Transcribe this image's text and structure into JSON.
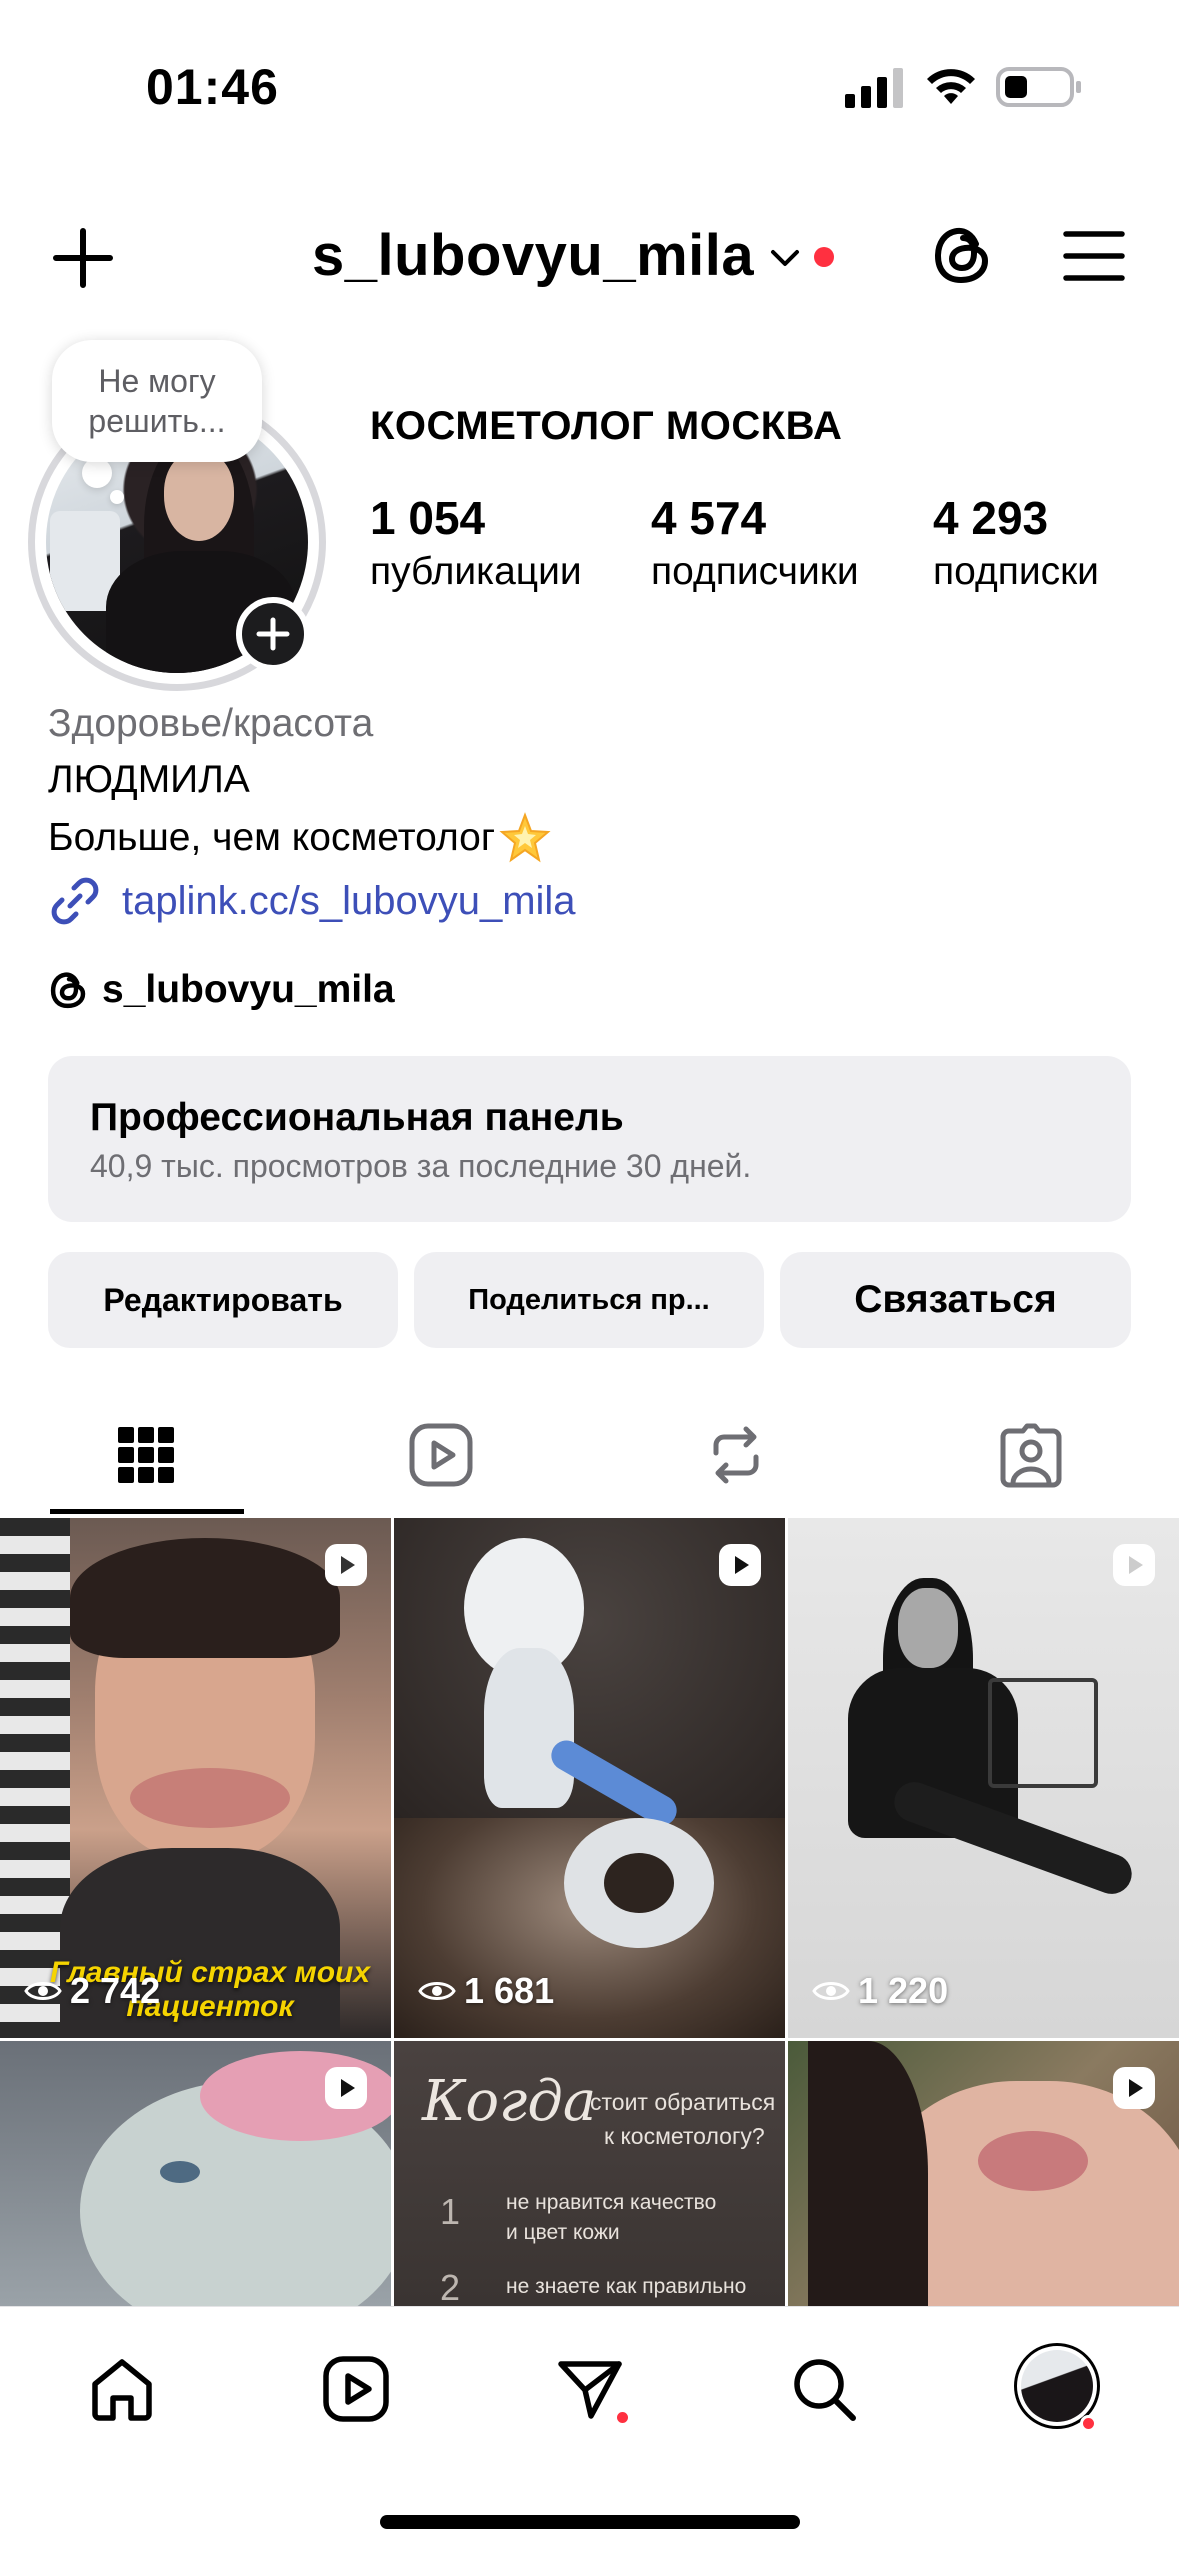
{
  "status_bar": {
    "time": "01:46"
  },
  "header": {
    "username": "s_lubovyu_mila"
  },
  "profile": {
    "note_line1": "Не могу",
    "note_line2": "решить...",
    "display_name": "КОСМЕТОЛОГ МОСКВА",
    "stats": [
      {
        "value": "1 054",
        "label": "публикации"
      },
      {
        "value": "4 574",
        "label": "подписчики"
      },
      {
        "value": "4 293",
        "label": "подписки"
      }
    ],
    "category": "Здоровье/красота",
    "bio_name": "ЛЮДМИЛА",
    "bio_text": "Больше, чем косметолог",
    "link": "taplink.cc/s_lubovyu_mila",
    "threads_handle": "s_lubovyu_mila"
  },
  "pro_panel": {
    "title": "Профессиональная панель",
    "subtitle": "40,9 тыс. просмотров за последние 30 дней."
  },
  "buttons": {
    "edit": "Редактировать",
    "share": "Поделиться пр...",
    "contact": "Связаться"
  },
  "tabs": [
    "grid-icon",
    "reels-icon",
    "reposts-icon",
    "tagged-icon"
  ],
  "grid": [
    {
      "views": "2 742",
      "caption": "Главный страх моих пациенток"
    },
    {
      "views": "1 681"
    },
    {
      "views": "1 220"
    },
    {},
    {
      "script_title": "Когда",
      "line1": "стоит обратиться",
      "line2": "к косметологу?",
      "num1": "1",
      "item1a": "не нравится качество",
      "item1b": "и цвет кожи",
      "num2": "2",
      "item2": "не знаете как правильно"
    },
    {}
  ],
  "bottom_nav": [
    "home-icon",
    "reels-icon",
    "messages-icon",
    "search-icon",
    "profile-avatar"
  ],
  "colors": {
    "accent_link": "#3d4fb8",
    "notification": "#ff3040",
    "panel_bg": "#efeff2"
  }
}
